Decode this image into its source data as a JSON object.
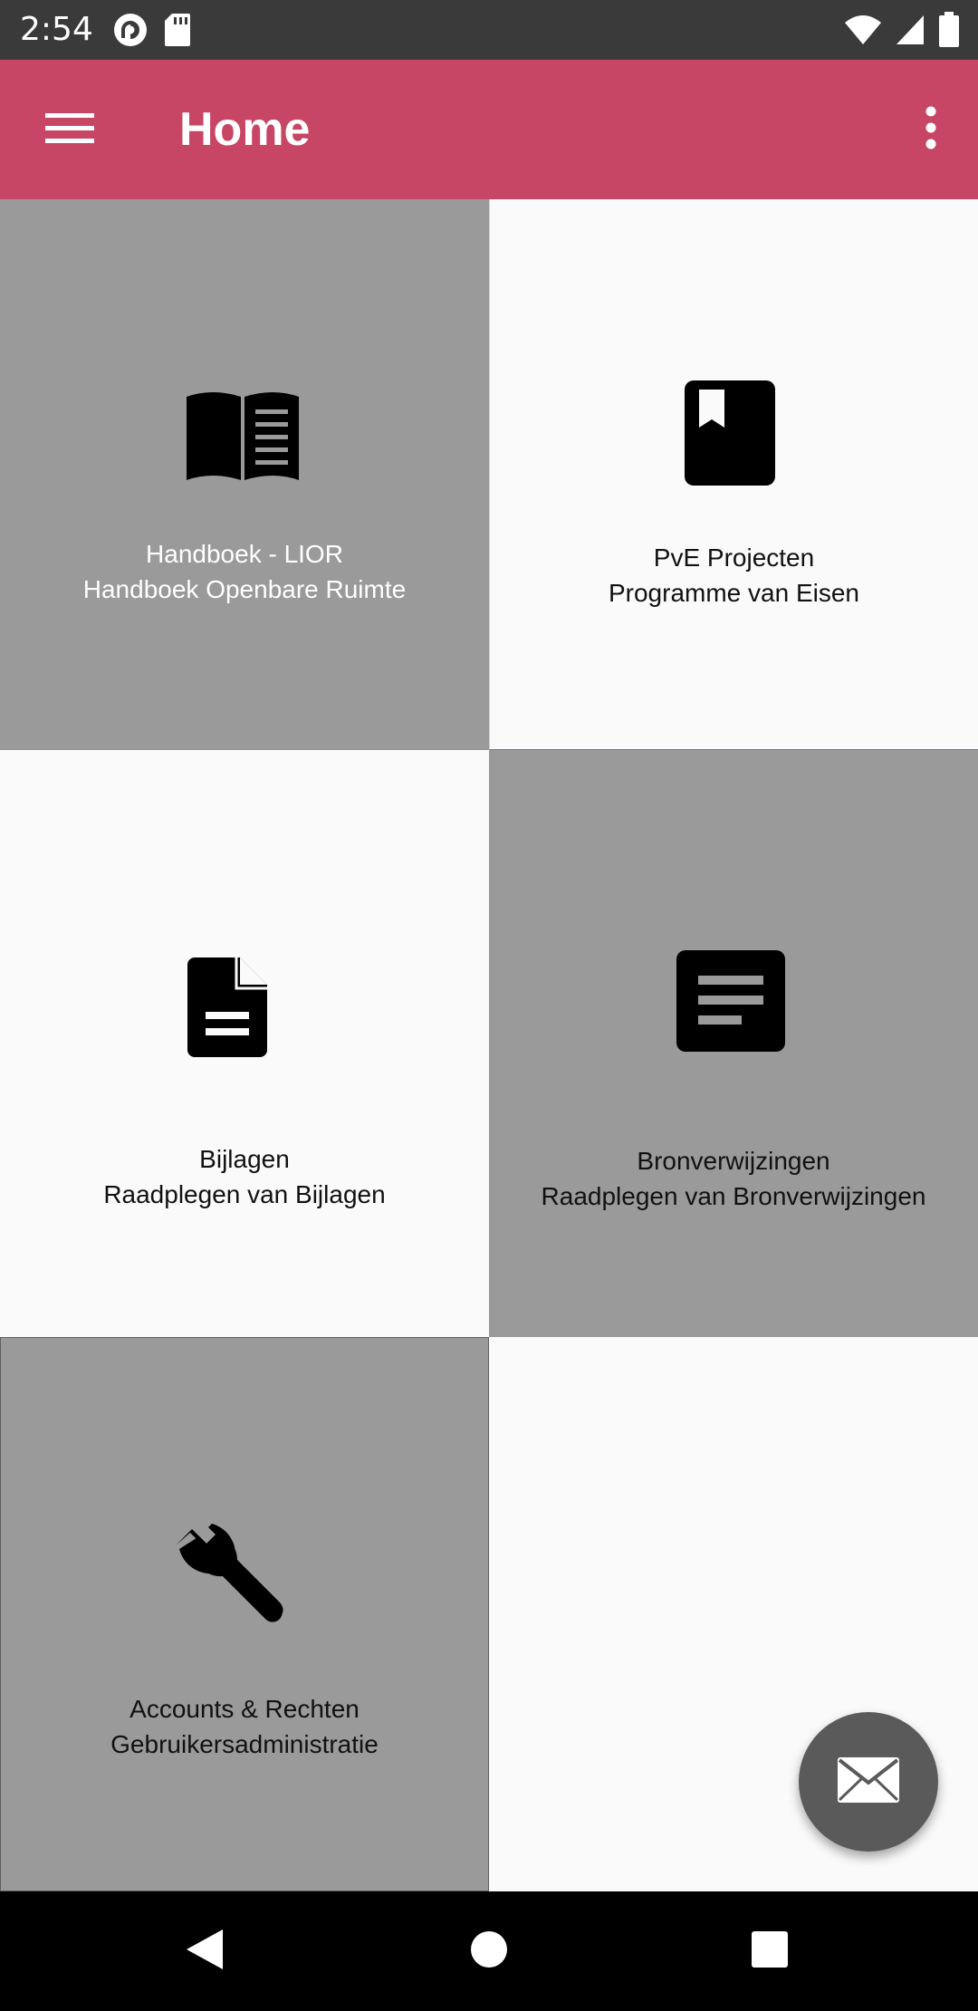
{
  "status_bar": {
    "time": "2:54",
    "left_icons": [
      "pocket-casts-icon",
      "sd-card-icon"
    ],
    "right_icons": [
      "wifi-icon",
      "cell-signal-icon",
      "battery-icon"
    ]
  },
  "app_bar": {
    "title": "Home",
    "background_color": "#c84665",
    "menu_icon": "hamburger-menu-icon",
    "overflow_icon": "more-vert-icon"
  },
  "tiles": [
    {
      "id": "handboek",
      "icon": "menu-book-icon",
      "title": "Handboek - LIOR",
      "subtitle": "Handboek Openbare Ruimte",
      "background": "gray"
    },
    {
      "id": "pve",
      "icon": "book-icon",
      "title": "PvE Projecten",
      "subtitle": "Programme van Eisen",
      "background": "white"
    },
    {
      "id": "bijlagen",
      "icon": "description-icon",
      "title": "Bijlagen",
      "subtitle": "Raadplegen van Bijlagen",
      "background": "white"
    },
    {
      "id": "bron",
      "icon": "article-icon",
      "title": "Bronverwijzingen",
      "subtitle": "Raadplegen van Bronverwijzingen",
      "background": "gray"
    },
    {
      "id": "accounts",
      "icon": "build-wrench-icon",
      "title": "Accounts & Rechten",
      "subtitle": "Gebruikersadministratie",
      "background": "gray"
    }
  ],
  "fab": {
    "icon": "mail-icon"
  },
  "nav_bar": {
    "buttons": [
      "back-icon",
      "home-icon",
      "recents-icon"
    ]
  },
  "colors": {
    "status_bar": "#3a3a3a",
    "tile_gray": "#9a9a9a",
    "tile_white": "#fafafa",
    "fab": "#5a5a5a",
    "nav_bar": "#000000"
  }
}
